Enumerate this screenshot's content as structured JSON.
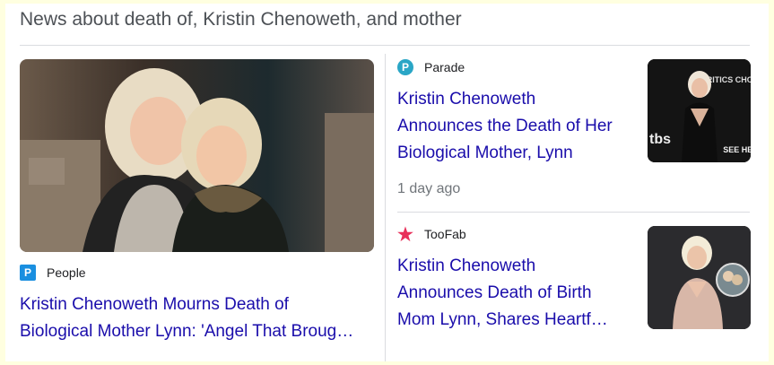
{
  "section": {
    "heading": "News about death of, Kristin Chenoweth, and mother"
  },
  "stories": [
    {
      "source": "People",
      "logo_letter": "P",
      "logo_color": "#1a8fe0",
      "headline_line1": "Kristin Chenoweth Mourns Death of",
      "headline_line2": "Biological Mother Lynn: 'Angel That Broug…"
    },
    {
      "source": "Parade",
      "logo_letter": "P",
      "logo_color": "#2aa6c6",
      "headline_line1": "Kristin Chenoweth",
      "headline_line2": "Announces the Death of Her",
      "headline_line3": "Biological Mother, Lynn",
      "time": "1 day ago",
      "thumb_sign_top": "CRITICS CHOICE",
      "thumb_sign_mid": "tbs",
      "thumb_sign_bottom": "SEE HER"
    },
    {
      "source": "TooFab",
      "logo_glyph": "★",
      "logo_color": "#e8305a",
      "headline_line1": "Kristin Chenoweth",
      "headline_line2": "Announces Death of Birth",
      "headline_line3": "Mom Lynn, Shares Heartf…"
    }
  ]
}
